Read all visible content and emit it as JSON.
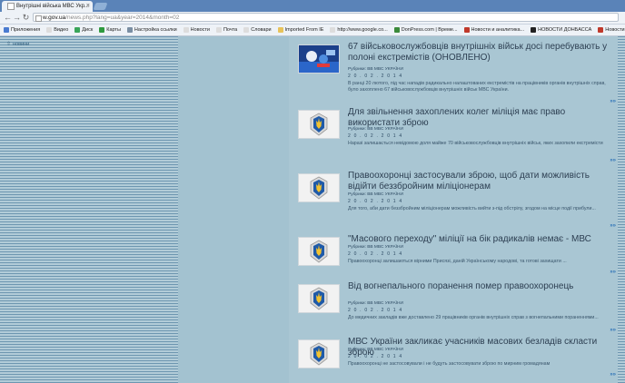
{
  "browser": {
    "tab_title": "Внутрішні війська МВС Укр...",
    "tab_close": "×",
    "url_host": "w.gov.ua",
    "url_path": "/news.php?lang=ua&year=2014&month=02",
    "bookmarks": [
      {
        "label": "Приложения",
        "icon": "apps-icon",
        "color": "#4a7bd0"
      },
      {
        "label": "Видео",
        "icon": "page-icon",
        "color": "#dddddd"
      },
      {
        "label": "Диск",
        "icon": "drive-icon",
        "color": "#3aa55a"
      },
      {
        "label": "Карты",
        "icon": "maps-icon",
        "color": "#2f9a3e"
      },
      {
        "label": "Настройка ссылки",
        "icon": "puzzle-icon",
        "color": "#7a8ea3"
      },
      {
        "label": "Новости",
        "icon": "page-icon",
        "color": "#dddddd"
      },
      {
        "label": "Почта",
        "icon": "page-icon",
        "color": "#dddddd"
      },
      {
        "label": "Словари",
        "icon": "page-icon",
        "color": "#dddddd"
      },
      {
        "label": "Imported From IE",
        "icon": "folder-icon",
        "color": "#e8c35a"
      },
      {
        "label": "http://www.google.co...",
        "icon": "page-icon",
        "color": "#dddddd"
      },
      {
        "label": "DonPress.com | Време...",
        "icon": "donpress-icon",
        "color": "#3b8a3b"
      },
      {
        "label": "Новости и аналитика...",
        "icon": "news-icon",
        "color": "#c0392b"
      },
      {
        "label": "НОВОСТИ ДОНБАССА",
        "icon": "news-icon",
        "color": "#222222"
      },
      {
        "label": "Новости Украины н...",
        "icon": "news-icon",
        "color": "#c0392b"
      }
    ]
  },
  "sidebar": {
    "arrow": "⇧",
    "link": "новини"
  },
  "news": [
    {
      "title": "67 військовослужбовців внутрішніх військ досі перебувають у полоні екстремістів (ОНОВЛЕНО)",
      "rubric": "Рубрики: ВВ МВС УКРАЇНИ",
      "date": "2 0 . 0 2 . 2 0 1 4",
      "summary": "В ранці 20 лютого, під час нападів радикально налаштованих екстремістів на працівників органів внутрішніх справ, було захоплено 67 військовослужбовців внутрішніх військ МВС України.",
      "more": "»»",
      "thumb": "photo"
    },
    {
      "title": "Для звільнення захоплених колег міліція має право використати зброю",
      "rubric": "Рубрики: ВВ МВС УКРАЇНИ",
      "date": "2 0 . 0 2 . 2 0 1 4",
      "summary": "Наразі залишається невідомою доля майже 70 військовослужбовців внутрішніх військ, яких захопили екстремісти",
      "more": "»»",
      "thumb": "emblem"
    },
    {
      "title": "Правоохоронці застосували зброю, щоб дати можливість відійти беззбройним міліціонерам",
      "rubric": "Рубрики: ВВ МВС УКРАЇНИ",
      "date": "2 0 . 0 2 . 2 0 1 4",
      "summary": "Для того, аби дати беззбройним міліціонерам можливість вийти з-під обстрілу, згодом на місце події прибули...",
      "more": "»»",
      "thumb": "emblem"
    },
    {
      "title": "\"Масового переходу\" міліції на бік радикалів немає - МВС",
      "rubric": "Рубрики: ВВ МВС УКРАЇНИ",
      "date": "2 0 . 0 2 . 2 0 1 4",
      "summary": "Правоохоронці залишаються вірними Присязі, даній Українському народові, та готові захищати ...",
      "more": "»»",
      "thumb": "emblem"
    },
    {
      "title": "Від вогнепального поранення помер правоохоронець",
      "rubric": "Рубрики: ВВ МВС УКРАЇНИ",
      "date": "2 0 . 0 2 . 2 0 1 4",
      "summary": "До медичних закладів вже доставлено 29 працівників органів внутрішніх справ з вогнепальними пораненнями...",
      "more": "»»",
      "thumb": "emblem"
    },
    {
      "title": "МВС України закликає учасників масових безладів скласти зброю",
      "rubric": "Рубрики: ВВ МВС УКРАЇНИ",
      "date": "2 0 . 0 2 . 2 0 1 4",
      "summary": "Правоохоронці не застосовували і не будуть застосовувати зброю по мирним громадянам",
      "more": "»»",
      "thumb": "emblem"
    }
  ]
}
